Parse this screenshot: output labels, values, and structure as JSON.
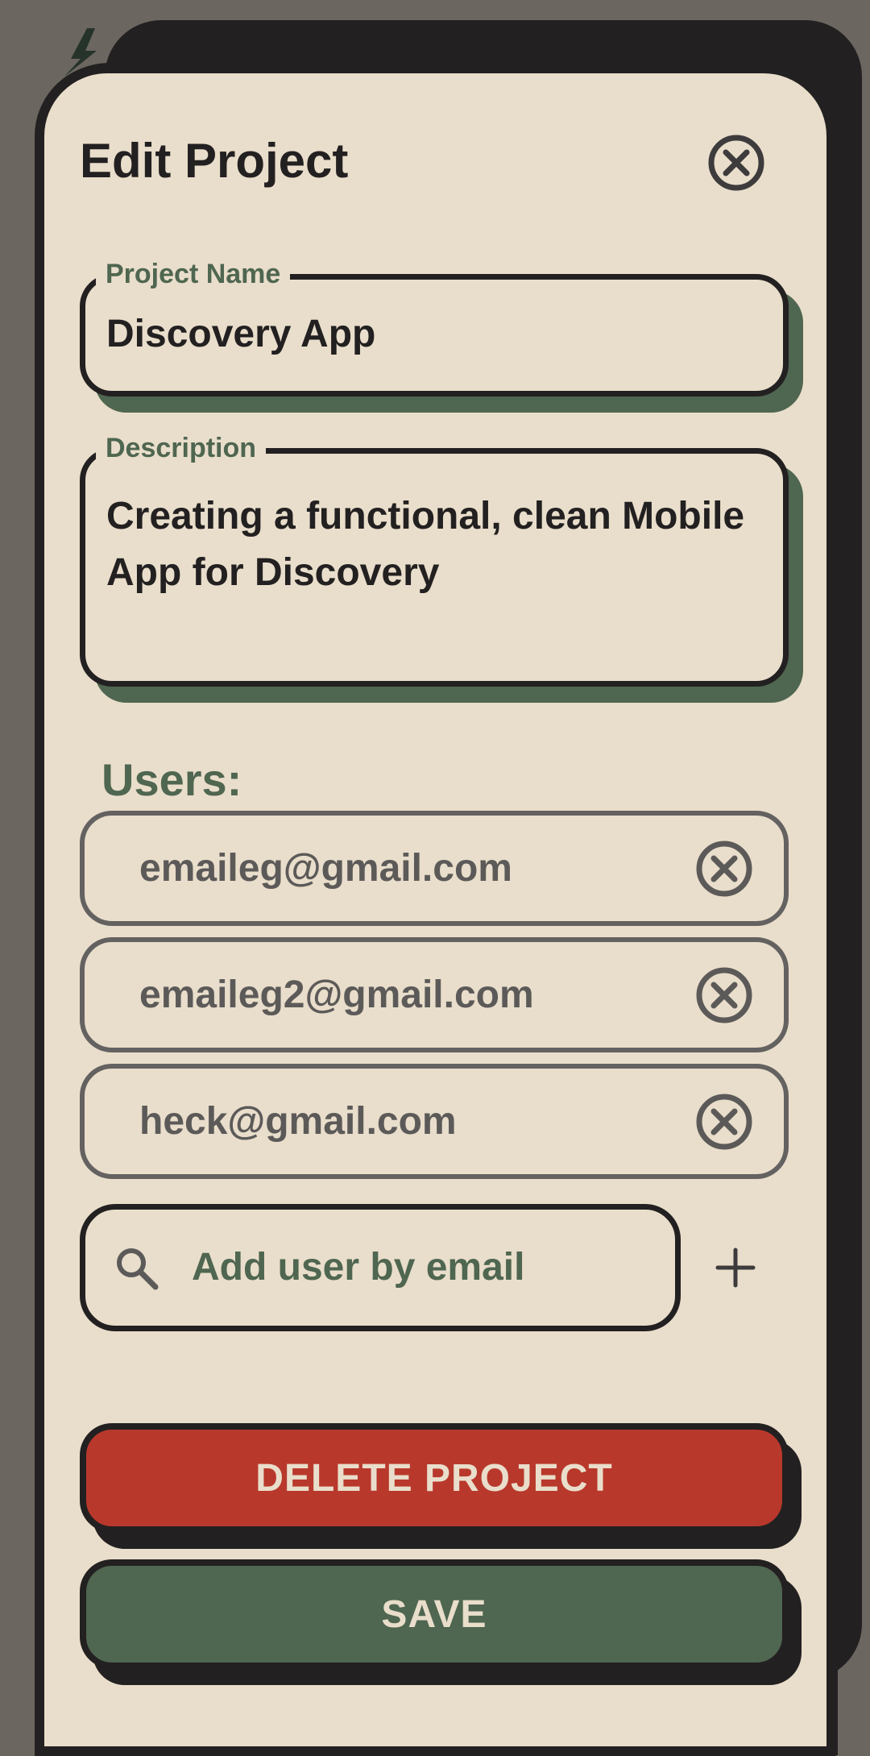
{
  "colors": {
    "background": "#6b6660",
    "surface": "#e9decb",
    "ink": "#232021",
    "accent_green": "#4f6650",
    "danger_red": "#b9382c",
    "muted_gray": "#5c5a59"
  },
  "modal": {
    "title": "Edit Project",
    "close_icon": "close-circle-icon"
  },
  "form": {
    "project_name": {
      "label": "Project Name",
      "value": "Discovery App"
    },
    "description": {
      "label": "Description",
      "value": "Creating a functional, clean Mobile App for Discovery"
    }
  },
  "users": {
    "label": "Users:",
    "items": [
      {
        "email": "emaileg@gmail.com",
        "remove_icon": "close-circle-icon"
      },
      {
        "email": "emaileg2@gmail.com",
        "remove_icon": "close-circle-icon"
      },
      {
        "email": "heck@gmail.com",
        "remove_icon": "close-circle-icon"
      }
    ],
    "add": {
      "placeholder": "Add user by email",
      "search_icon": "search-icon",
      "add_icon": "plus-icon"
    }
  },
  "actions": {
    "delete_label": "DELETE PROJECT",
    "save_label": "SAVE"
  }
}
